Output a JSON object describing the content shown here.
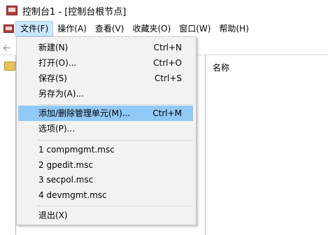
{
  "window": {
    "title": "控制台1 - [控制台根节点]"
  },
  "menubar": {
    "items": [
      {
        "label": "文件(F)"
      },
      {
        "label": "操作(A)"
      },
      {
        "label": "查看(V)"
      },
      {
        "label": "收藏夹(O)"
      },
      {
        "label": "窗口(W)"
      },
      {
        "label": "帮助(H)"
      }
    ]
  },
  "file_menu": {
    "new": {
      "label": "新建(N)",
      "shortcut": "Ctrl+N"
    },
    "open": {
      "label": "打开(O)...",
      "shortcut": "Ctrl+O"
    },
    "save": {
      "label": "保存(S)",
      "shortcut": "Ctrl+S"
    },
    "save_as": {
      "label": "另存为(A)..."
    },
    "add_remove_snapin": {
      "label": "添加/删除管理单元(M)...",
      "shortcut": "Ctrl+M"
    },
    "options": {
      "label": "选项(P)..."
    },
    "recent": [
      {
        "label": "1 compmgmt.msc"
      },
      {
        "label": "2 gpedit.msc"
      },
      {
        "label": "3 secpol.msc"
      },
      {
        "label": "4 devmgmt.msc"
      }
    ],
    "exit": {
      "label": "退出(X)"
    }
  },
  "content": {
    "name_column": "名称"
  },
  "colors": {
    "highlight": "#91c9f7",
    "menu_active": "#cce8ff",
    "menu_bg": "#f2f2f2"
  },
  "icons": {
    "app": "mmc-console-icon",
    "back": "back-arrow-icon",
    "tree_node": "folder-icon"
  }
}
